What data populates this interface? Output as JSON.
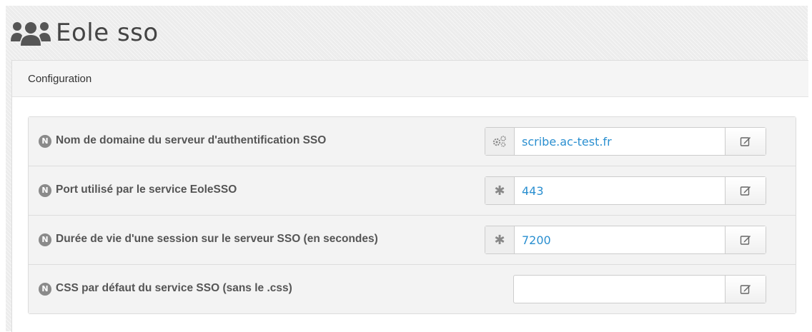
{
  "title": "Eole sso",
  "panel": {
    "heading": "Configuration"
  },
  "fields": [
    {
      "badge": "N",
      "label": "Nom de domaine du serveur d'authentification SSO",
      "addon_icon": "gears-icon",
      "value": "scribe.ac-test.fr"
    },
    {
      "badge": "N",
      "label": "Port utilisé par le service EoleSSO",
      "addon_icon": "asterisk-icon",
      "addon_text": "✱",
      "value": "443"
    },
    {
      "badge": "N",
      "label": "Durée de vie d'une session sur le serveur SSO (en secondes)",
      "addon_icon": "asterisk-icon",
      "addon_text": "✱",
      "value": "7200"
    },
    {
      "badge": "N",
      "label": "CSS par défaut du service SSO (sans le .css)",
      "value": ""
    }
  ],
  "colors": {
    "value_text": "#2a8fd0",
    "badge_bg": "#8a8a8a"
  }
}
